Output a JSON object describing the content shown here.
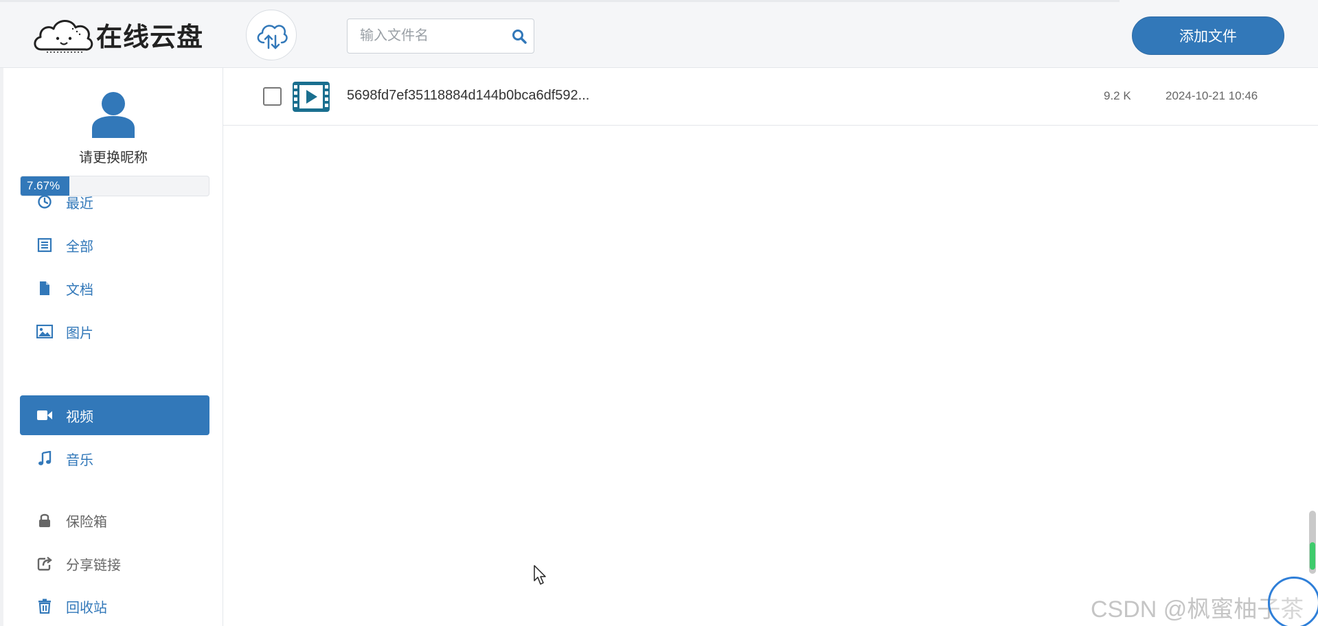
{
  "app": {
    "title": "在线云盘"
  },
  "header": {
    "upload_icon": "cloud-upload-icon",
    "search": {
      "placeholder": "输入文件名",
      "value": ""
    },
    "add_file_label": "添加文件"
  },
  "sidebar": {
    "nickname": "请更换昵称",
    "storage_used_percent": 7.67,
    "storage_used_label": "7.67%",
    "nav": [
      {
        "label": "最近",
        "icon": "clock-icon",
        "active": false
      },
      {
        "label": "全部",
        "icon": "list-icon",
        "active": false
      },
      {
        "label": "文档",
        "icon": "document-icon",
        "active": false
      },
      {
        "label": "图片",
        "icon": "image-icon",
        "active": false
      },
      {
        "label": "视频",
        "icon": "video-camera-icon",
        "active": true
      },
      {
        "label": "音乐",
        "icon": "music-note-icon",
        "active": false
      }
    ],
    "extra": [
      {
        "label": "保险箱",
        "icon": "lock-icon"
      },
      {
        "label": "分享链接",
        "icon": "share-icon"
      },
      {
        "label": "回收站",
        "icon": "trash-icon"
      }
    ]
  },
  "files": [
    {
      "name": "5698fd7ef35118884d144b0bca6df592...",
      "size": "9.2 K",
      "modified": "2024-10-21 10:46",
      "type_icon": "video-file-icon"
    }
  ],
  "watermark": "CSDN @枫蜜柚子茶",
  "colors": {
    "accent": "#3278b9",
    "file_icon": "#1a6f8f",
    "header_bg": "#f5f6f8"
  }
}
